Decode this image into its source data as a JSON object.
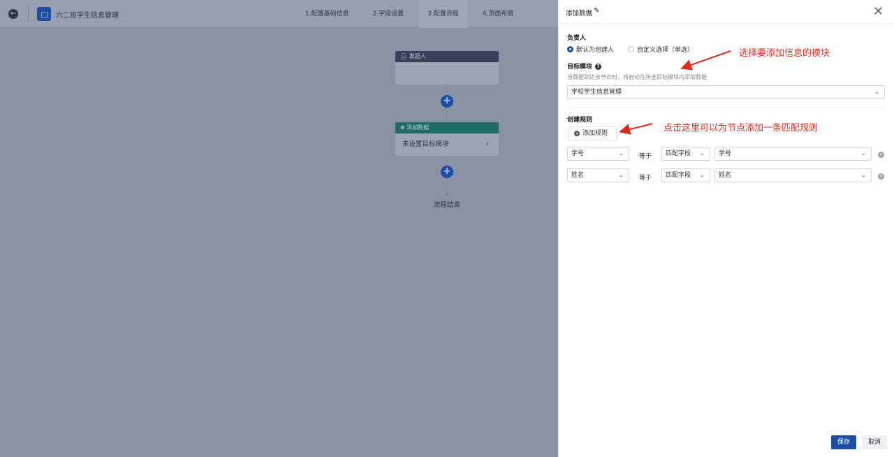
{
  "header": {
    "app_title": "六二班学生信息管理",
    "steps": [
      "1.配置基础信息",
      "2.字段设置",
      "3.配置流程",
      "4.页面布局"
    ],
    "active_step": 2
  },
  "flow": {
    "start_node": {
      "title": "发起人",
      "icon": "user-icon"
    },
    "action_node": {
      "title": "添加数据",
      "body": "未设置目标模块",
      "icon": "plus-circle-icon"
    },
    "end_label": "流程结束"
  },
  "panel": {
    "title": "添加数据",
    "owner_label": "负责人",
    "owner_options": [
      "默认为创建人",
      "自定义选择（单选）"
    ],
    "owner_selected": 0,
    "target_label": "目标模块",
    "target_hint": "当数据到达该节点时，将自动在所选目标模块内添加数据",
    "target_value": "学校学生信息管理",
    "rules_label": "创建规则",
    "add_rule_label": "添加规则",
    "rules": [
      {
        "field": "学号",
        "operator": "等于",
        "match_type": "匹配字段",
        "value": "学号"
      },
      {
        "field": "姓名",
        "operator": "等于",
        "match_type": "匹配字段",
        "value": "姓名"
      }
    ],
    "save_label": "保存",
    "cancel_label": "取消"
  },
  "annotations": {
    "target_note": "选择要添加信息的模块",
    "rule_note": "点击这里可以为节点添加一条匹配规则",
    "color": "#e5281c"
  },
  "colors": {
    "accent": "#1b4fa6",
    "node_green": "#1f6b66",
    "node_dark": "#37425a"
  }
}
